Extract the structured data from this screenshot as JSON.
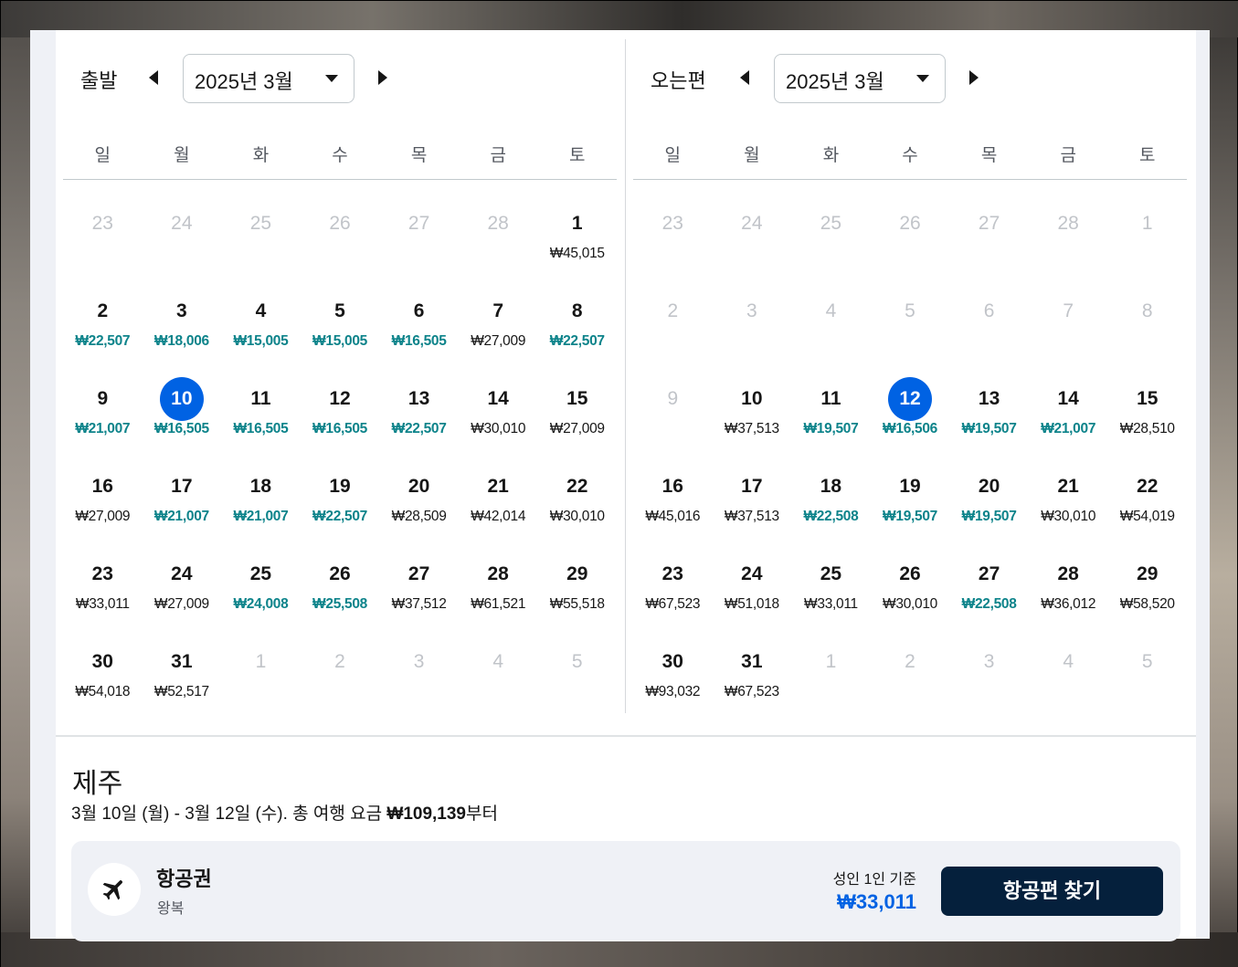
{
  "colors": {
    "accent": "#0062e3",
    "low_price": "#0c838a",
    "button_bg": "#05203c",
    "muted_day": "#c1c4c9"
  },
  "weekdays": [
    "일",
    "월",
    "화",
    "수",
    "목",
    "금",
    "토"
  ],
  "outbound": {
    "label": "출발",
    "month_select": "2025년 3월",
    "prev_icon": "caret-left-icon",
    "next_icon": "caret-right-icon",
    "weeks": [
      [
        {
          "d": "23",
          "muted": true
        },
        {
          "d": "24",
          "muted": true
        },
        {
          "d": "25",
          "muted": true
        },
        {
          "d": "26",
          "muted": true
        },
        {
          "d": "27",
          "muted": true
        },
        {
          "d": "28",
          "muted": true
        },
        {
          "d": "1",
          "p": "₩45,015"
        }
      ],
      [
        {
          "d": "2",
          "p": "₩22,507",
          "low": true
        },
        {
          "d": "3",
          "p": "₩18,006",
          "low": true
        },
        {
          "d": "4",
          "p": "₩15,005",
          "low": true
        },
        {
          "d": "5",
          "p": "₩15,005",
          "low": true
        },
        {
          "d": "6",
          "p": "₩16,505",
          "low": true
        },
        {
          "d": "7",
          "p": "₩27,009"
        },
        {
          "d": "8",
          "p": "₩22,507",
          "low": true
        }
      ],
      [
        {
          "d": "9",
          "p": "₩21,007",
          "low": true
        },
        {
          "d": "10",
          "p": "₩16,505",
          "low": true,
          "sel": true
        },
        {
          "d": "11",
          "p": "₩16,505",
          "low": true
        },
        {
          "d": "12",
          "p": "₩16,505",
          "low": true
        },
        {
          "d": "13",
          "p": "₩22,507",
          "low": true
        },
        {
          "d": "14",
          "p": "₩30,010"
        },
        {
          "d": "15",
          "p": "₩27,009"
        }
      ],
      [
        {
          "d": "16",
          "p": "₩27,009"
        },
        {
          "d": "17",
          "p": "₩21,007",
          "low": true
        },
        {
          "d": "18",
          "p": "₩21,007",
          "low": true
        },
        {
          "d": "19",
          "p": "₩22,507",
          "low": true
        },
        {
          "d": "20",
          "p": "₩28,509"
        },
        {
          "d": "21",
          "p": "₩42,014"
        },
        {
          "d": "22",
          "p": "₩30,010"
        }
      ],
      [
        {
          "d": "23",
          "p": "₩33,011"
        },
        {
          "d": "24",
          "p": "₩27,009"
        },
        {
          "d": "25",
          "p": "₩24,008",
          "low": true
        },
        {
          "d": "26",
          "p": "₩25,508",
          "low": true
        },
        {
          "d": "27",
          "p": "₩37,512"
        },
        {
          "d": "28",
          "p": "₩61,521"
        },
        {
          "d": "29",
          "p": "₩55,518"
        }
      ],
      [
        {
          "d": "30",
          "p": "₩54,018"
        },
        {
          "d": "31",
          "p": "₩52,517"
        },
        {
          "d": "1",
          "muted": true
        },
        {
          "d": "2",
          "muted": true
        },
        {
          "d": "3",
          "muted": true
        },
        {
          "d": "4",
          "muted": true
        },
        {
          "d": "5",
          "muted": true
        }
      ]
    ]
  },
  "inbound": {
    "label": "오는편",
    "month_select": "2025년 3월",
    "prev_icon": "caret-left-icon",
    "next_icon": "caret-right-icon",
    "weeks": [
      [
        {
          "d": "23",
          "muted": true
        },
        {
          "d": "24",
          "muted": true
        },
        {
          "d": "25",
          "muted": true
        },
        {
          "d": "26",
          "muted": true
        },
        {
          "d": "27",
          "muted": true
        },
        {
          "d": "28",
          "muted": true
        },
        {
          "d": "1",
          "muted": true
        }
      ],
      [
        {
          "d": "2",
          "muted": true
        },
        {
          "d": "3",
          "muted": true
        },
        {
          "d": "4",
          "muted": true
        },
        {
          "d": "5",
          "muted": true
        },
        {
          "d": "6",
          "muted": true
        },
        {
          "d": "7",
          "muted": true
        },
        {
          "d": "8",
          "muted": true
        }
      ],
      [
        {
          "d": "9",
          "muted": true
        },
        {
          "d": "10",
          "p": "₩37,513"
        },
        {
          "d": "11",
          "p": "₩19,507",
          "low": true
        },
        {
          "d": "12",
          "p": "₩16,506",
          "low": true,
          "sel": true
        },
        {
          "d": "13",
          "p": "₩19,507",
          "low": true
        },
        {
          "d": "14",
          "p": "₩21,007",
          "low": true
        },
        {
          "d": "15",
          "p": "₩28,510"
        }
      ],
      [
        {
          "d": "16",
          "p": "₩45,016"
        },
        {
          "d": "17",
          "p": "₩37,513"
        },
        {
          "d": "18",
          "p": "₩22,508",
          "low": true
        },
        {
          "d": "19",
          "p": "₩19,507",
          "low": true
        },
        {
          "d": "20",
          "p": "₩19,507",
          "low": true
        },
        {
          "d": "21",
          "p": "₩30,010"
        },
        {
          "d": "22",
          "p": "₩54,019"
        }
      ],
      [
        {
          "d": "23",
          "p": "₩67,523"
        },
        {
          "d": "24",
          "p": "₩51,018"
        },
        {
          "d": "25",
          "p": "₩33,011"
        },
        {
          "d": "26",
          "p": "₩30,010"
        },
        {
          "d": "27",
          "p": "₩22,508",
          "low": true
        },
        {
          "d": "28",
          "p": "₩36,012"
        },
        {
          "d": "29",
          "p": "₩58,520"
        }
      ],
      [
        {
          "d": "30",
          "p": "₩93,032"
        },
        {
          "d": "31",
          "p": "₩67,523"
        },
        {
          "d": "1",
          "muted": true
        },
        {
          "d": "2",
          "muted": true
        },
        {
          "d": "3",
          "muted": true
        },
        {
          "d": "4",
          "muted": true
        },
        {
          "d": "5",
          "muted": true
        }
      ]
    ]
  },
  "summary": {
    "destination": "제주",
    "dates_text": "3월 10일 (월) - 3월 12일 (수).  총 여행 요금 ",
    "total_price": "₩109,139",
    "total_suffix": "부터"
  },
  "flight_card": {
    "icon": "airplane-icon",
    "title": "항공권",
    "subtitle": "왕복",
    "basis": "성인 1인 기준",
    "price": "₩33,011",
    "button_label": "항공편 찾기"
  }
}
